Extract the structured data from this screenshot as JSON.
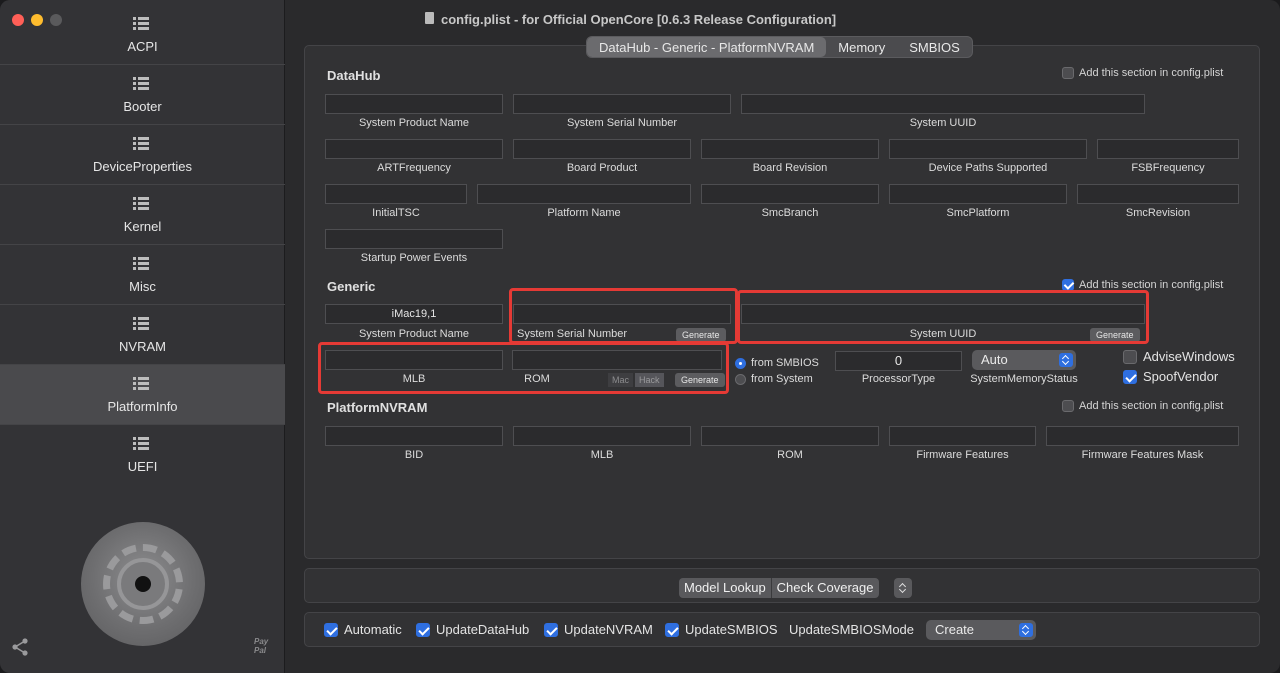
{
  "window": {
    "title": "config.plist - for Official OpenCore [0.6.3 Release Configuration]"
  },
  "sidebar": {
    "items": [
      {
        "label": "ACPI",
        "active": false
      },
      {
        "label": "Booter",
        "active": false
      },
      {
        "label": "DeviceProperties",
        "active": false
      },
      {
        "label": "Kernel",
        "active": false
      },
      {
        "label": "Misc",
        "active": false
      },
      {
        "label": "NVRAM",
        "active": false
      },
      {
        "label": "PlatformInfo",
        "active": true
      },
      {
        "label": "UEFI",
        "active": false
      }
    ],
    "paypal_text": "Pay Pal"
  },
  "tabs": [
    "DataHub - Generic - PlatformNVRAM",
    "Memory",
    "SMBIOS"
  ],
  "selected_tab": "DataHub - Generic - PlatformNVRAM",
  "datahub": {
    "title": "DataHub",
    "add_label": "Add this section in config.plist",
    "add_checked": false,
    "fields": {
      "system_product_name": {
        "label": "System Product Name",
        "value": ""
      },
      "system_serial_number": {
        "label": "System Serial Number",
        "value": ""
      },
      "system_uuid": {
        "label": "System UUID",
        "value": ""
      },
      "art_frequency": {
        "label": "ARTFrequency",
        "value": ""
      },
      "board_product": {
        "label": "Board Product",
        "value": ""
      },
      "board_revision": {
        "label": "Board Revision",
        "value": ""
      },
      "device_paths_supported": {
        "label": "Device Paths Supported",
        "value": ""
      },
      "fsb_frequency": {
        "label": "FSBFrequency",
        "value": ""
      },
      "initial_tsc": {
        "label": "InitialTSC",
        "value": ""
      },
      "platform_name": {
        "label": "Platform Name",
        "value": ""
      },
      "smc_branch": {
        "label": "SmcBranch",
        "value": ""
      },
      "smc_platform": {
        "label": "SmcPlatform",
        "value": ""
      },
      "smc_revision": {
        "label": "SmcRevision",
        "value": ""
      },
      "startup_power_events": {
        "label": "Startup Power Events",
        "value": ""
      }
    }
  },
  "generic": {
    "title": "Generic",
    "add_label": "Add this section in config.plist",
    "add_checked": true,
    "system_product_name": {
      "label": "System Product Name",
      "value": "iMac19,1"
    },
    "system_serial_number": {
      "label": "System Serial Number",
      "value": ""
    },
    "system_uuid": {
      "label": "System UUID",
      "value": ""
    },
    "mlb": {
      "label": "MLB",
      "value": ""
    },
    "rom": {
      "label": "ROM",
      "value": ""
    },
    "generate_label": "Generate",
    "rom_mac_label": "Mac",
    "rom_hack_label": "Hack",
    "from_smbios_label": "from SMBIOS",
    "from_system_label": "from System",
    "from_smbios_selected": true,
    "processor_type": {
      "label": "ProcessorType",
      "value": "0"
    },
    "system_memory_status": {
      "label": "SystemMemoryStatus",
      "value": "Auto"
    },
    "advise_windows": {
      "label": "AdviseWindows",
      "checked": false
    },
    "spoof_vendor": {
      "label": "SpoofVendor",
      "checked": true
    }
  },
  "platform_nvram": {
    "title": "PlatformNVRAM",
    "add_label": "Add this section in config.plist",
    "add_checked": false,
    "fields": {
      "bid": {
        "label": "BID",
        "value": ""
      },
      "mlb": {
        "label": "MLB",
        "value": ""
      },
      "rom": {
        "label": "ROM",
        "value": ""
      },
      "firmware_features": {
        "label": "Firmware Features",
        "value": ""
      },
      "firmware_features_mask": {
        "label": "Firmware Features Mask",
        "value": ""
      }
    }
  },
  "lookup": {
    "model_lookup": "Model Lookup",
    "check_coverage": "Check Coverage"
  },
  "footer": {
    "automatic": {
      "label": "Automatic",
      "checked": true
    },
    "update_datahub": {
      "label": "UpdateDataHub",
      "checked": true
    },
    "update_nvram": {
      "label": "UpdateNVRAM",
      "checked": true
    },
    "update_smbios": {
      "label": "UpdateSMBIOS",
      "checked": true
    },
    "update_smbios_mode_label": "UpdateSMBIOSMode",
    "update_smbios_mode_value": "Create"
  },
  "colors": {
    "accent": "#2f6fe0",
    "highlight_box": "#e53a35",
    "sidebar_active": "#4a4a4d"
  }
}
